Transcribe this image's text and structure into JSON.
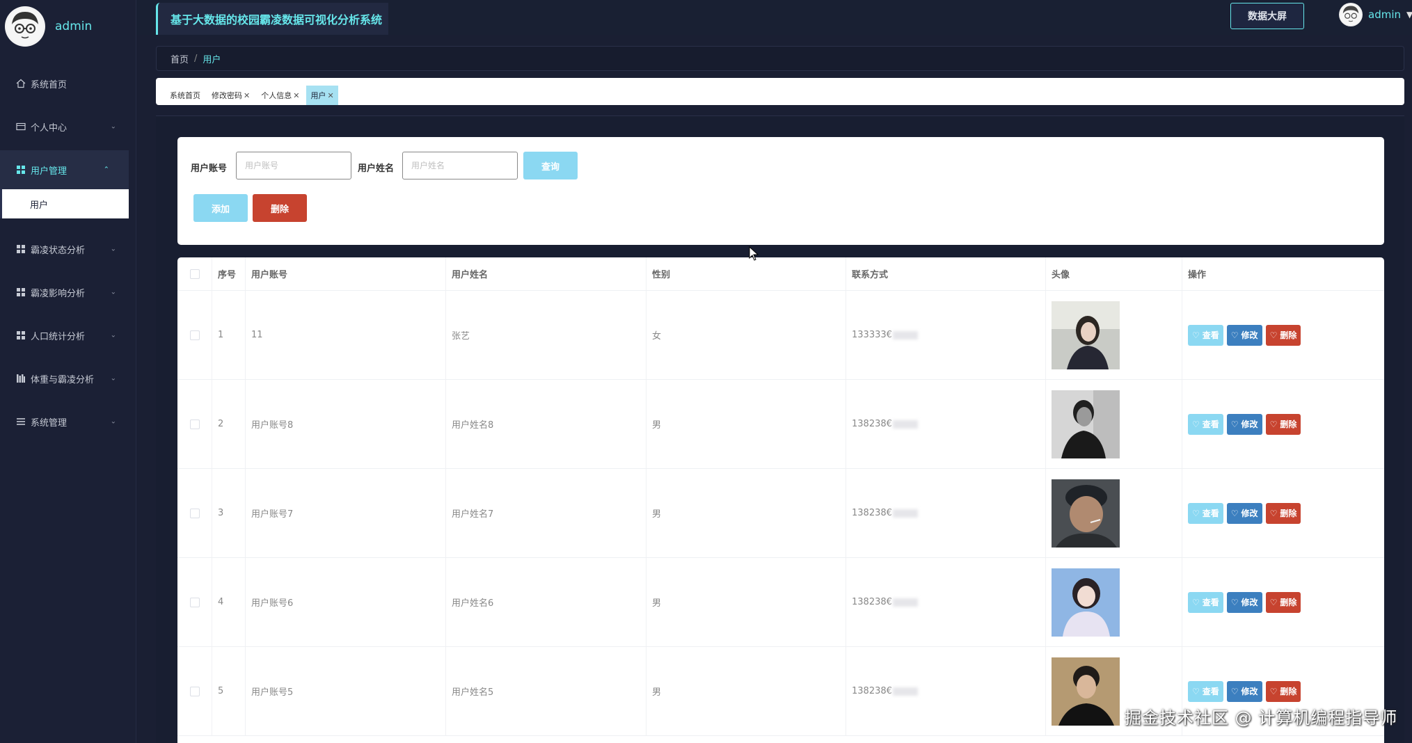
{
  "sidebar": {
    "username": "admin",
    "items": [
      {
        "label": "系统首页",
        "icon": "home-icon"
      },
      {
        "label": "个人中心",
        "icon": "id-card-icon"
      },
      {
        "label": "用户管理",
        "icon": "grid-icon"
      },
      {
        "label": "霸凌状态分析",
        "icon": "grid-icon"
      },
      {
        "label": "霸凌影响分析",
        "icon": "grid-icon"
      },
      {
        "label": "人口统计分析",
        "icon": "grid-icon"
      },
      {
        "label": "体重与霸凌分析",
        "icon": "books-icon"
      },
      {
        "label": "系统管理",
        "icon": "list-icon"
      }
    ],
    "submenu_label": "用户"
  },
  "topbar": {
    "title": "基于大数据的校园霸凌数据可视化分析系统",
    "screen_button": "数据大屏",
    "username": "admin"
  },
  "breadcrumb": {
    "home": "首页",
    "separator": "/",
    "current": "用户"
  },
  "tabs": [
    {
      "label": "系统首页",
      "closable": false
    },
    {
      "label": "修改密码",
      "closable": true
    },
    {
      "label": "个人信息",
      "closable": true
    },
    {
      "label": "用户",
      "closable": true
    }
  ],
  "search": {
    "account_label": "用户账号",
    "account_placeholder": "用户账号",
    "name_label": "用户姓名",
    "name_placeholder": "用户姓名",
    "query_button": "查询",
    "add_button": "添加",
    "delete_button": "删除"
  },
  "table": {
    "headers": [
      "序号",
      "用户账号",
      "用户姓名",
      "性别",
      "联系方式",
      "头像",
      "操作"
    ],
    "ops": {
      "view": "查看",
      "edit": "修改",
      "delete": "删除"
    },
    "rows": [
      {
        "index": "1",
        "account": "11",
        "name": "张艺",
        "gender": "女",
        "phone": "133333€"
      },
      {
        "index": "2",
        "account": "用户账号8",
        "name": "用户姓名8",
        "gender": "男",
        "phone": "138238€"
      },
      {
        "index": "3",
        "account": "用户账号7",
        "name": "用户姓名7",
        "gender": "男",
        "phone": "138238€"
      },
      {
        "index": "4",
        "account": "用户账号6",
        "name": "用户姓名6",
        "gender": "男",
        "phone": "138238€"
      },
      {
        "index": "5",
        "account": "用户账号5",
        "name": "用户姓名5",
        "gender": "男",
        "phone": "138238€"
      }
    ]
  },
  "watermark": "掘金技术社区 @ 计算机编程指导师",
  "colors": {
    "accent": "#66e6ea",
    "sidebar_bg": "#1b2035",
    "primary_btn": "#8bd8f2",
    "danger_btn": "#c7432f",
    "edit_btn": "#3c7fbf"
  }
}
